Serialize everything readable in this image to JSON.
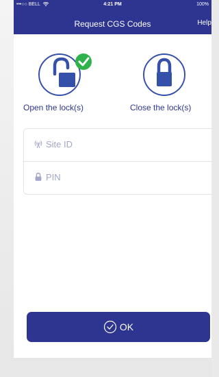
{
  "status": {
    "carrier": "•••○○ BELL",
    "time": "4:21 PM",
    "battery": "100%"
  },
  "nav": {
    "title": "Request CGS Codes",
    "help": "Help ("
  },
  "actions": {
    "open_label": "Open the lock(s)",
    "close_label": "Close the lock(s)"
  },
  "form": {
    "site_id_placeholder": "Site ID",
    "pin_placeholder": "PIN"
  },
  "button": {
    "ok_label": "OK"
  },
  "colors": {
    "brand": "#2d3590",
    "check": "#2fb24c",
    "icon_blue": "#3550a8"
  },
  "icons": [
    "wifi-icon",
    "lock-open-icon",
    "checkmark-badge-icon",
    "lock-closed-icon",
    "signal-tower-icon",
    "padlock-icon",
    "check-circle-icon"
  ]
}
